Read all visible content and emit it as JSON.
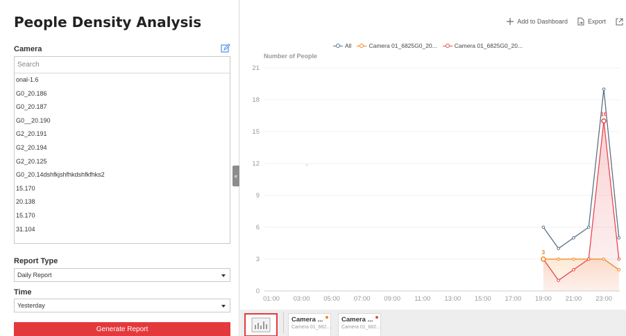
{
  "left": {
    "title": "People Density Analysis",
    "camera_label": "Camera",
    "search_placeholder": "Search",
    "cameras": [
      "onal-1.6",
      "G0_20.186",
      "G0_20.187",
      "G0__20.190",
      "G2_20.191",
      "G2_20.194",
      "G2_20.125",
      "G0_20.14dshfkjshfhkdshfkfhks2",
      "15.170",
      "20.138",
      "15.170",
      "31.104"
    ],
    "report_type_label": "Report Type",
    "report_type_value": "Daily Report",
    "time_label": "Time",
    "time_value": "Yesterday",
    "generate_label": "Generate Report",
    "collapse_glyph": "«"
  },
  "toolbar": {
    "add_label": "Add to Dashboard",
    "export_label": "Export"
  },
  "colors": {
    "accent": "#e4393c",
    "all": "#5b7083",
    "camera1": "#f08519",
    "camera2": "#e8474c"
  },
  "chart_data": {
    "type": "line",
    "ylabel": "Number of People",
    "ylim": [
      0,
      21
    ],
    "yticks": [
      0,
      3,
      6,
      9,
      12,
      15,
      18,
      21
    ],
    "x_labels": [
      "01:00",
      "03:00",
      "05:00",
      "07:00",
      "09:00",
      "11:00",
      "13:00",
      "15:00",
      "17:00",
      "19:00",
      "21:00",
      "23:00"
    ],
    "x": [
      "19:00",
      "20:00",
      "21:00",
      "22:00",
      "23:00",
      "24:00"
    ],
    "series": [
      {
        "name": "All",
        "color": "#5b7083",
        "values": [
          6,
          4,
          5,
          6,
          19,
          5
        ]
      },
      {
        "name": "Camera 01_6825G0_20...",
        "color": "#f08519",
        "values": [
          3,
          3,
          3,
          3,
          3,
          2
        ]
      },
      {
        "name": "Camera 01_6825G0_20...",
        "color": "#e8474c",
        "values": [
          3,
          1,
          2,
          3,
          16,
          3
        ]
      }
    ],
    "data_labels": [
      {
        "series": 1,
        "x": "19:00",
        "text": "3"
      },
      {
        "series": 2,
        "x": "23:00",
        "text": "16"
      }
    ]
  },
  "thumbnails": [
    {
      "title": "Camera ...",
      "subtitle": "Camera 01_682...",
      "dot_color": "#f08519"
    },
    {
      "title": "Camera ...",
      "subtitle": "Camera 01_682...",
      "dot_color": "#e8474c"
    }
  ]
}
